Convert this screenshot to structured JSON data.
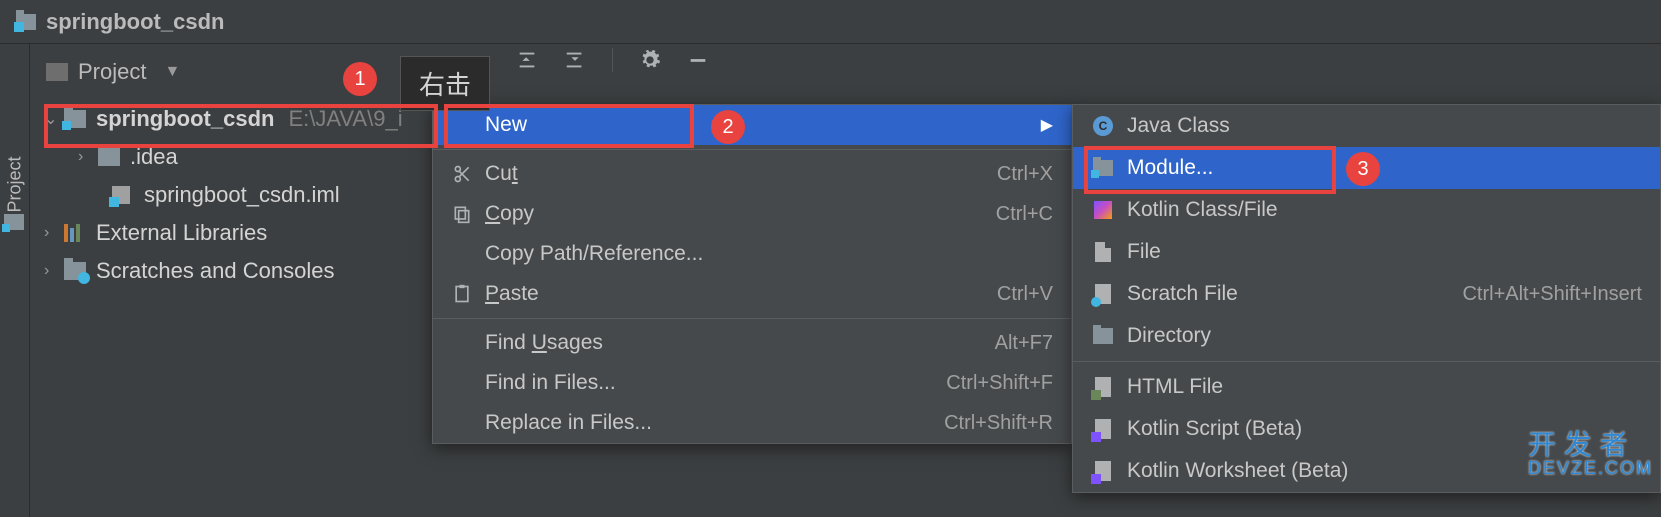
{
  "titlebar": {
    "project_name": "springboot_csdn"
  },
  "sidebar_tab": {
    "label": "Project"
  },
  "project_selector": {
    "label": "Project"
  },
  "tree": {
    "root": {
      "name": "springboot_csdn",
      "path": "E:\\JAVA\\9_i"
    },
    "children": [
      {
        "name": ".idea"
      },
      {
        "name": "springboot_csdn.iml"
      }
    ],
    "external_libs": "External Libraries",
    "scratches": "Scratches and Consoles"
  },
  "tooltip": {
    "text": "右击"
  },
  "markers": {
    "m1": "1",
    "m2": "2",
    "m3": "3"
  },
  "context_menu": {
    "new": "New",
    "cut": {
      "label": "Cut",
      "shortcut": "Ctrl+X"
    },
    "copy": {
      "label": "Copy",
      "shortcut": "Ctrl+C"
    },
    "copy_path": "Copy Path/Reference...",
    "paste": {
      "label": "Paste",
      "shortcut": "Ctrl+V"
    },
    "find_usages": {
      "label": "Find Usages",
      "shortcut": "Alt+F7"
    },
    "find_in_files": {
      "label": "Find in Files...",
      "shortcut": "Ctrl+Shift+F"
    },
    "replace_in_files": {
      "label": "Replace in Files...",
      "shortcut": "Ctrl+Shift+R"
    }
  },
  "new_submenu": {
    "java_class": "Java Class",
    "module": "Module...",
    "kotlin_class": "Kotlin Class/File",
    "file": "File",
    "scratch_file": {
      "label": "Scratch File",
      "shortcut": "Ctrl+Alt+Shift+Insert"
    },
    "directory": "Directory",
    "html_file": "HTML File",
    "kotlin_script": "Kotlin Script (Beta)",
    "kotlin_worksheet": "Kotlin Worksheet (Beta)"
  },
  "watermark": {
    "line1": "开 发 者",
    "line2": "DEVZE.COM"
  }
}
